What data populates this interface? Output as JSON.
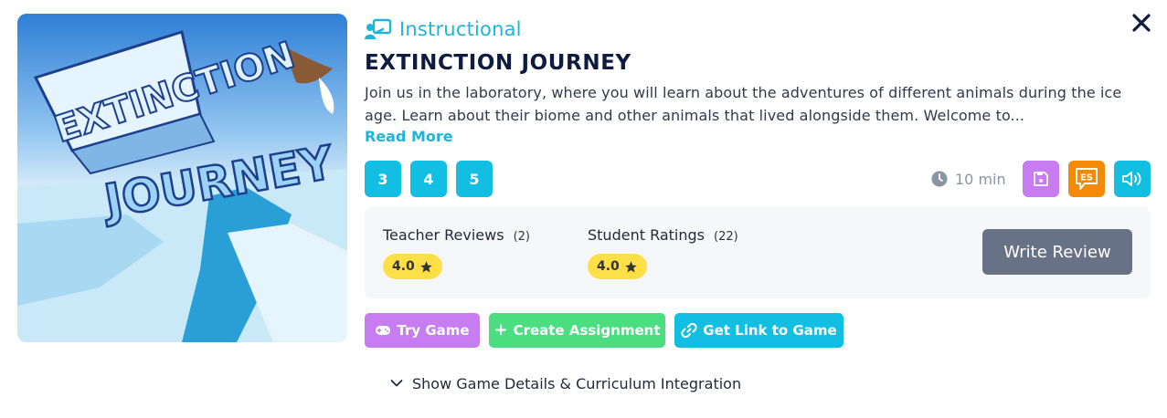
{
  "game": {
    "category": "Instructional",
    "title": "EXTINCTION JOURNEY",
    "description": "Join us in the laboratory, where you will learn about the adventures of different animals during the ice age. Learn about their biome and other animals that lived alongside them. Welcome to...",
    "read_more": "Read More",
    "thumbnail_text": [
      "EXTINCTION",
      "JOURNEY"
    ]
  },
  "grades": [
    "3",
    "4",
    "5"
  ],
  "duration": "10 min",
  "toolbar_icons": [
    {
      "name": "save-icon",
      "color": "#c77cf2"
    },
    {
      "name": "spanish-language-icon",
      "label": "ES",
      "color": "#f58a07"
    },
    {
      "name": "audio-icon",
      "color": "#12bfe3"
    }
  ],
  "reviews": {
    "teacher": {
      "label": "Teacher Reviews",
      "count": "(2)",
      "rating": "4.0"
    },
    "student": {
      "label": "Student Ratings",
      "count": "(22)",
      "rating": "4.0"
    },
    "write_review": "Write Review"
  },
  "actions": {
    "try_game": "Try Game",
    "create_assignment": "Create Assignment",
    "get_link": "Get Link to Game"
  },
  "colors": {
    "accent": "#12bfe3",
    "try_game": "#c77cf2",
    "create_assignment": "#4ade80",
    "get_link": "#12bfe3",
    "rating": "#fde047",
    "title": "#0f1c3f"
  },
  "details_toggle": "Show Game Details & Curriculum Integration"
}
